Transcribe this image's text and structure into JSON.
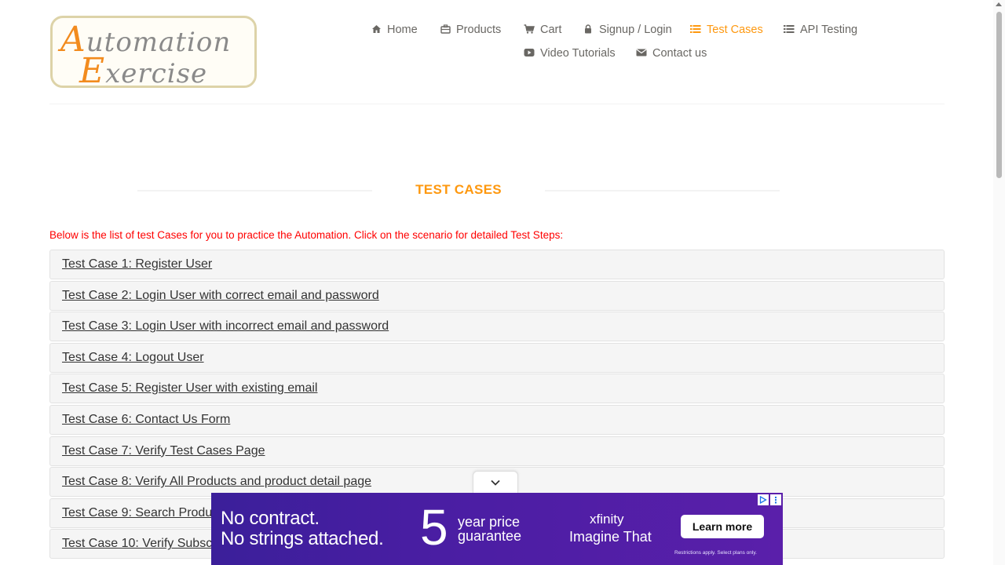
{
  "logo": {
    "line1_cap": "A",
    "line1_rest": "utomation",
    "line2_cap": "E",
    "line2_rest": "xercise"
  },
  "nav": {
    "items": [
      {
        "icon": "home-icon",
        "label": "Home"
      },
      {
        "icon": "briefcase-icon",
        "label": "Products"
      },
      {
        "icon": "cart-icon",
        "label": "Cart"
      },
      {
        "icon": "lock-icon",
        "label": "Signup / Login"
      },
      {
        "icon": "list-icon",
        "label": "Test Cases",
        "active": true
      },
      {
        "icon": "list-icon",
        "label": "API Testing"
      },
      {
        "icon": "youtube-play-icon",
        "label": "Video Tutorials"
      },
      {
        "icon": "envelope-icon",
        "label": "Contact us"
      }
    ]
  },
  "page": {
    "title": "TEST CASES",
    "intro": "Below is the list of test Cases for you to practice the Automation. Click on the scenario for detailed Test Steps:"
  },
  "test_cases": [
    "Test Case 1: Register User",
    "Test Case 2: Login User with correct email and password",
    "Test Case 3: Login User with incorrect email and password",
    "Test Case 4: Logout User",
    "Test Case 5: Register User with existing email",
    "Test Case 6: Contact Us Form",
    "Test Case 7: Verify Test Cases Page",
    "Test Case 8: Verify All Products and product detail page",
    "Test Case 9: Search Produ",
    "Test Case 10: Verify Subsc"
  ],
  "ad": {
    "headline_1": "No contract.",
    "headline_2": "No strings attached.",
    "big_number": "5",
    "price_line_1": "year price",
    "price_line_2": "guarantee",
    "brand": "xfinity",
    "tagline": "Imagine That",
    "cta": "Learn more",
    "fine_print": "Restrictions apply. Select plans only."
  },
  "colors": {
    "accent": "#fe980f",
    "intro_text": "#ff0000",
    "ad_bg": "#4a1ea3"
  }
}
